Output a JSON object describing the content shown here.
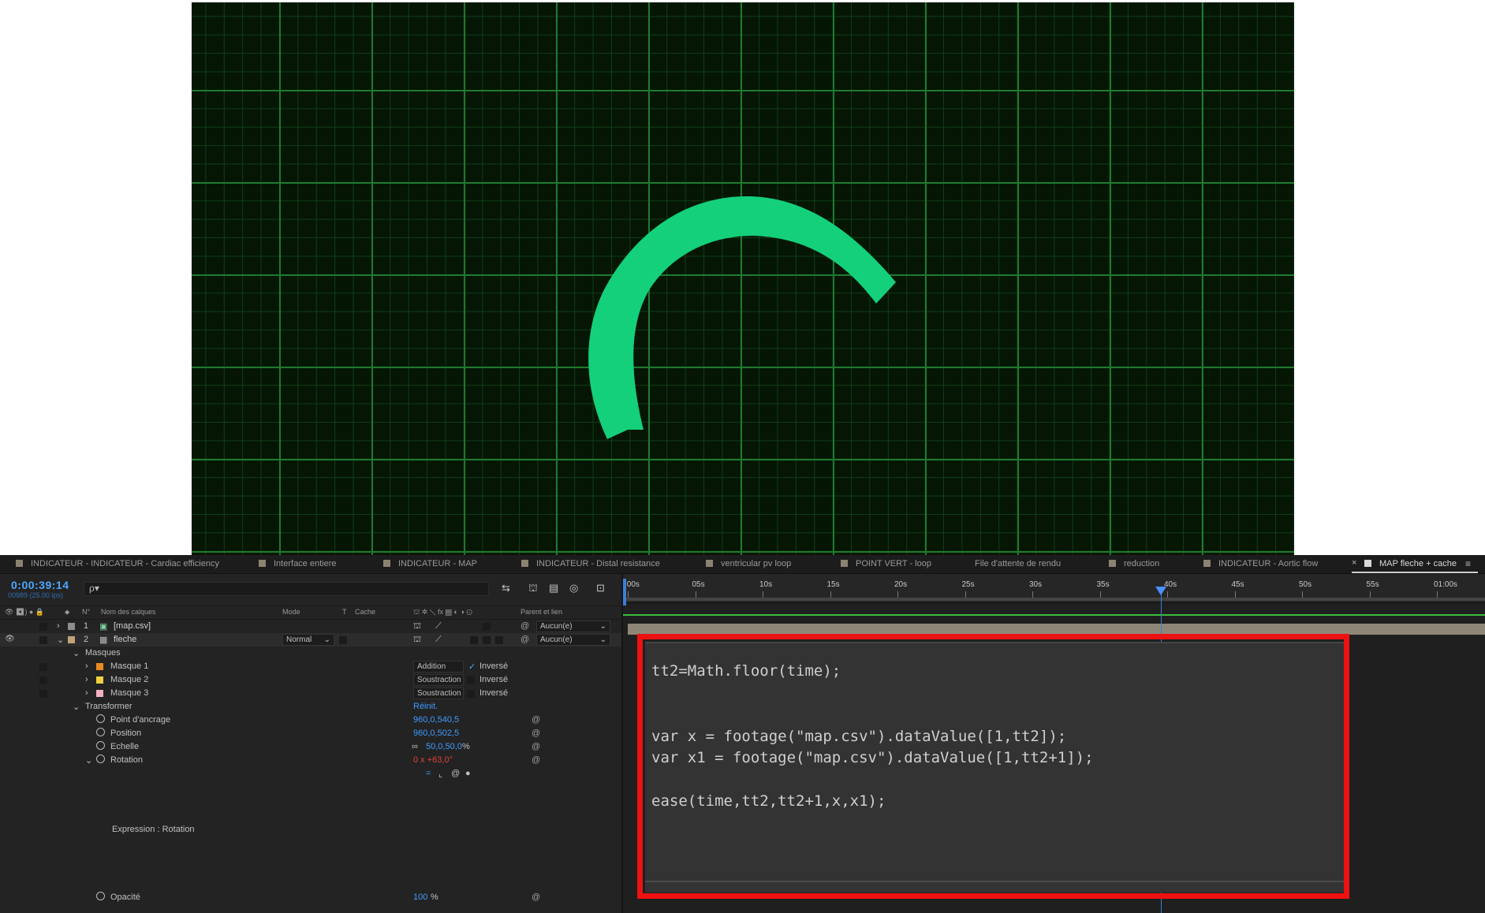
{
  "viewer": {
    "background_color": "#051605",
    "grid_color": "#1f7a2e",
    "arc_color": "#14d07a"
  },
  "tabs": [
    {
      "label": "INDICATEUR - INDICATEUR - Cardiac efficiency",
      "swatch": "#8b8270"
    },
    {
      "label": "Interface entiere",
      "swatch": "#8b8270"
    },
    {
      "label": "INDICATEUR - MAP",
      "swatch": "#8b8270"
    },
    {
      "label": "INDICATEUR - Distal resistance",
      "swatch": "#8b8270"
    },
    {
      "label": "ventricular pv loop",
      "swatch": "#8b8270"
    },
    {
      "label": "POINT VERT - loop",
      "swatch": "#8b8270"
    },
    {
      "label": "File d'attente de rendu",
      "swatch": ""
    },
    {
      "label": "reduction",
      "swatch": "#8b8270"
    },
    {
      "label": "INDICATEUR - Aortic flow",
      "swatch": "#8b8270"
    },
    {
      "label": "MAP fleche + cache",
      "swatch": "#d9d9d9",
      "active": true
    }
  ],
  "tab_close": "×",
  "panel_menu": "≡",
  "timeline": {
    "timecode": "0:00:39:14",
    "frames": "00989 (25.00 ips)",
    "search_icon": "ρ▾",
    "columns": {
      "num": "N°",
      "layer_name": "Nom des calques",
      "mode": "Mode",
      "t": "T",
      "cache": "Cache",
      "parent": "Parent et lien"
    },
    "layers": [
      {
        "num": "1",
        "name": "[map.csv]",
        "parent": "Aucun(e)",
        "color": "#8e8e8e"
      },
      {
        "num": "2",
        "name": "fleche",
        "mode": "Normal",
        "parent": "Aucun(e)",
        "color": "#c2a27a"
      }
    ],
    "masks_group": "Masques",
    "masks": [
      {
        "name": "Masque 1",
        "mode": "Addition",
        "inverted_label": "Inversé",
        "inverted": true,
        "color": "#e88a1e"
      },
      {
        "name": "Masque 2",
        "mode": "Soustraction",
        "inverted_label": "Inversé",
        "inverted": false,
        "color": "#f0d040"
      },
      {
        "name": "Masque 3",
        "mode": "Soustraction",
        "inverted_label": "Inversé",
        "inverted": false,
        "color": "#f2b0c2"
      }
    ],
    "transform_group": "Transformer",
    "reset_label": "Réinit.",
    "props": [
      {
        "name": "Point d'ancrage",
        "value": "960,0,540,5"
      },
      {
        "name": "Position",
        "value": "960,0,502,5"
      },
      {
        "name": "Echelle",
        "value": "50,0,50,0",
        "unit": "%",
        "link_icon": "∞"
      },
      {
        "name": "Rotation",
        "value": "0 x +63,0°"
      }
    ],
    "expression_label": "Expression : Rotation",
    "opacity": {
      "name": "Opacité",
      "value": "100",
      "unit": "%"
    },
    "ruler_ticks": [
      ":00s",
      "05s",
      "10s",
      "15s",
      "20s",
      "25s",
      "30s",
      "35s",
      "40s",
      "45s",
      "50s",
      "55s",
      "01:00s"
    ],
    "playhead_seconds": 39.56
  },
  "expression": {
    "code": "tt2=Math.floor(time);\n\n\nvar x = footage(\"map.csv\").dataValue([1,tt2]);\nvar x1 = footage(\"map.csv\").dataValue([1,tt2+1]);\n\nease(time,tt2,tt2+1,x,x1);"
  }
}
